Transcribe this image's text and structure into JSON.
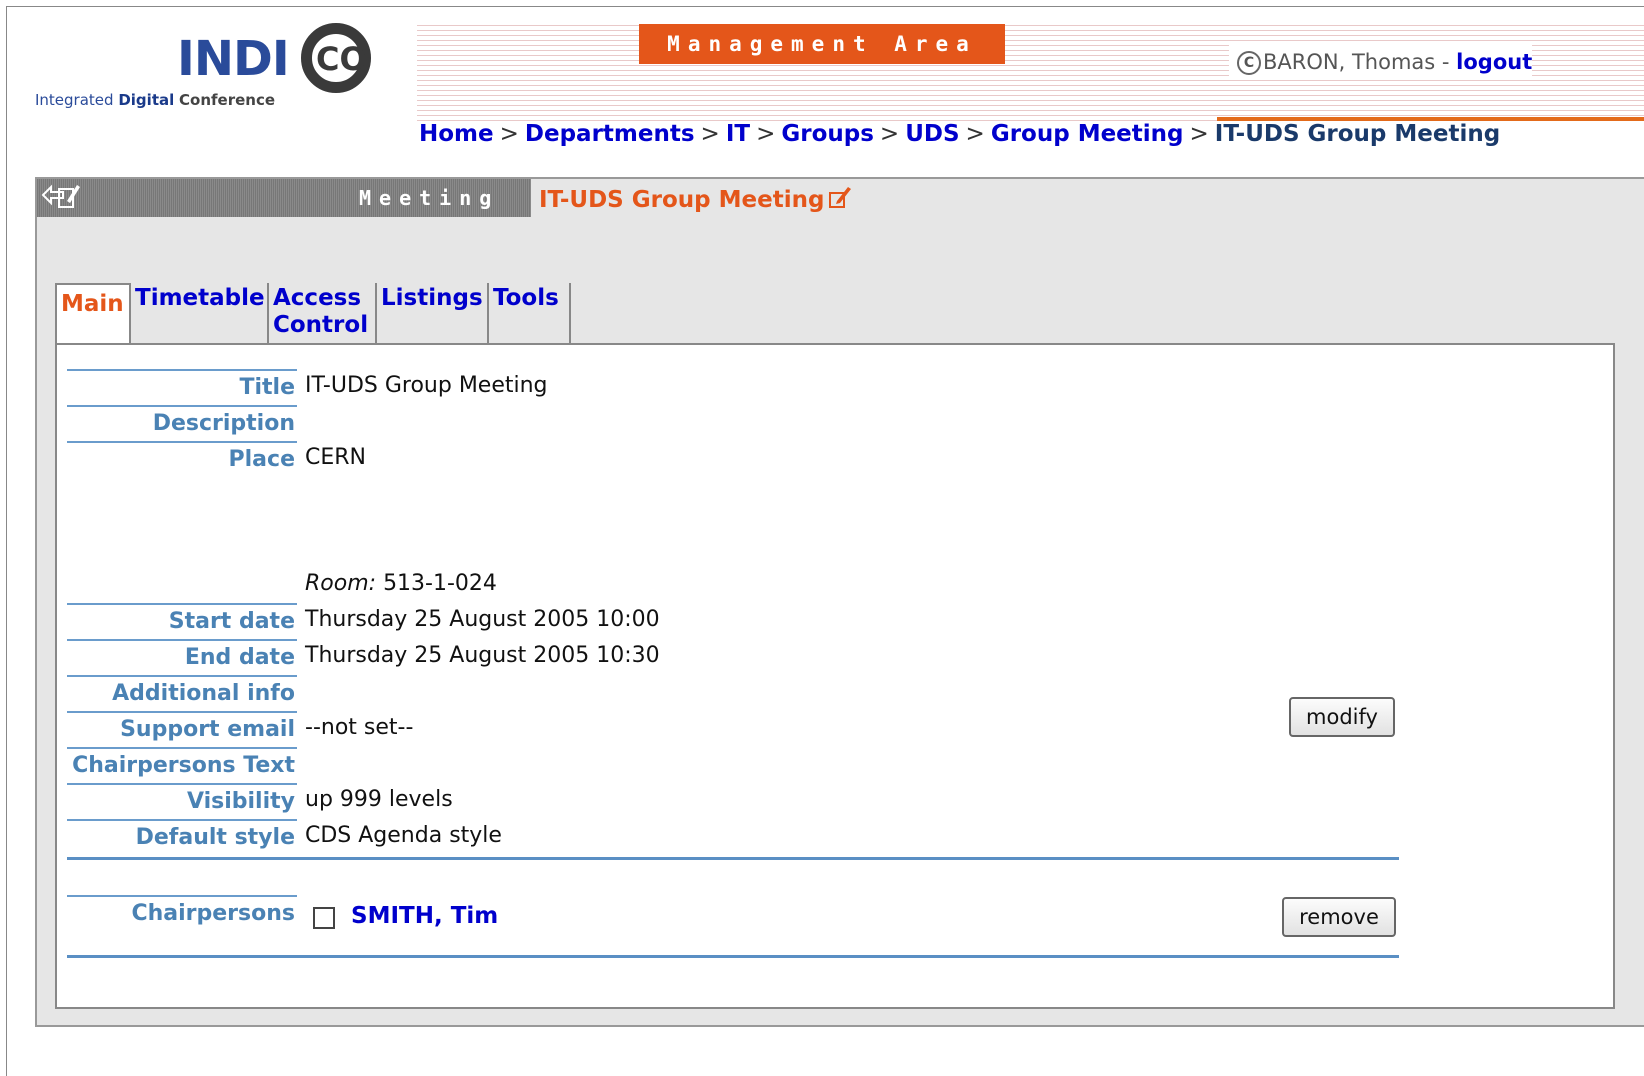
{
  "header": {
    "logo_word": "INDI",
    "logo_circle": "CO",
    "logo_sub_1": "Integrated",
    "logo_sub_2": "Digital",
    "logo_sub_3": "Conference",
    "management_area": "Management Area",
    "user_icon": "C",
    "user_name": "BARON, Thomas",
    "user_sep": "-",
    "logout": "logout"
  },
  "breadcrumb": [
    {
      "label": "Home",
      "link": true
    },
    {
      "label": "Departments",
      "link": true
    },
    {
      "label": "IT",
      "link": true
    },
    {
      "label": "Groups",
      "link": true
    },
    {
      "label": "UDS",
      "link": true
    },
    {
      "label": "Group Meeting",
      "link": true
    },
    {
      "label": "IT-UDS Group Meeting",
      "link": false
    }
  ],
  "breadcrumb_sep": ">",
  "conference": {
    "type_label": "Meeting",
    "title": "IT-UDS Group Meeting"
  },
  "tabs": [
    {
      "label": "Main",
      "active": true
    },
    {
      "label": "Timetable",
      "active": false
    },
    {
      "label": "Access Control",
      "active": false
    },
    {
      "label": "Listings",
      "active": false
    },
    {
      "label": "Tools",
      "active": false
    }
  ],
  "info": {
    "title_label": "Title",
    "title_value": "IT-UDS Group Meeting",
    "description_label": "Description",
    "description_value": "",
    "place_label": "Place",
    "place_value": "CERN",
    "room_label": "Room:",
    "room_value": "513-1-024",
    "start_label": "Start date",
    "start_value": "Thursday 25 August 2005 10:00",
    "end_label": "End date",
    "end_value": "Thursday 25 August 2005 10:30",
    "additional_label": "Additional info",
    "additional_value": "",
    "support_label": "Support email",
    "support_value": "--not set--",
    "chairtext_label": "Chairpersons Text",
    "chairtext_value": "",
    "visibility_label": "Visibility",
    "visibility_value": "up 999 levels",
    "style_label": "Default style",
    "style_value": "CDS Agenda style",
    "modify_button": "modify"
  },
  "chairpersons": {
    "label": "Chairpersons",
    "items": [
      {
        "name": "SMITH, Tim",
        "checked": false
      }
    ],
    "remove_button": "remove"
  },
  "colors": {
    "accent_orange": "#e4561a",
    "link_blue": "#0000cc",
    "label_blue": "#4a82b4"
  }
}
